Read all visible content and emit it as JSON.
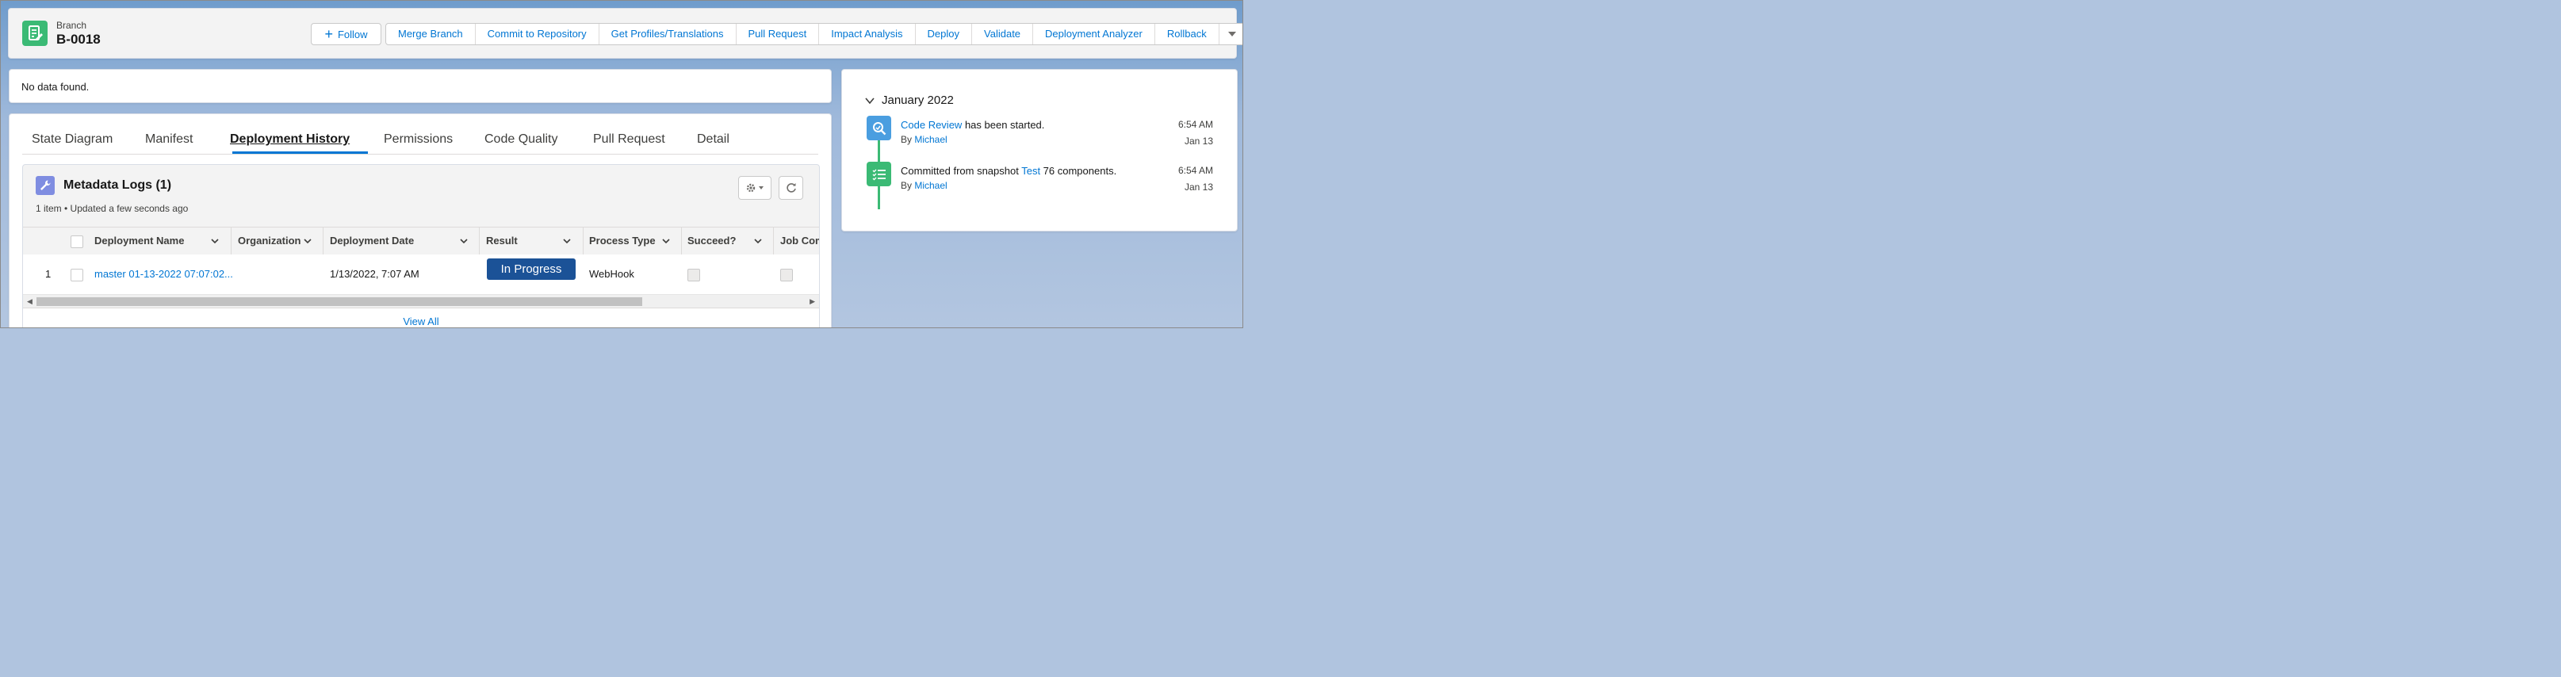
{
  "header": {
    "object_type": "Branch",
    "record_name": "B-0018",
    "follow_label": "Follow",
    "actions": [
      "Merge Branch",
      "Commit to Repository",
      "Get Profiles/Translations",
      "Pull Request",
      "Impact Analysis",
      "Deploy",
      "Validate",
      "Deployment Analyzer",
      "Rollback"
    ]
  },
  "notice": {
    "text": "No data found."
  },
  "tabs": [
    "State Diagram",
    "Manifest",
    "Deployment History",
    "Permissions",
    "Code Quality",
    "Pull Request",
    "Detail"
  ],
  "related_list": {
    "title": "Metadata Logs (1)",
    "subtitle": "1 item • Updated a few seconds ago",
    "columns": [
      "Deployment Name",
      "Organization",
      "Deployment Date",
      "Result",
      "Process Type",
      "Succeed?",
      "Job Com"
    ],
    "rows": [
      {
        "index": "1",
        "deployment_name": "master 01-13-2022 07:07:02...",
        "organization": "",
        "deployment_date": "1/13/2022, 7:07 AM",
        "result": "In Progress",
        "process_type": "WebHook"
      }
    ],
    "view_all": "View All"
  },
  "activity": {
    "month": "January 2022",
    "events": [
      {
        "link": "Code Review",
        "text": " has been started.",
        "by_prefix": "By ",
        "by": "Michael",
        "time": "6:54 AM",
        "date": "Jan 13"
      },
      {
        "prefix": "Committed from snapshot ",
        "link": "Test",
        "text": " 76 components.",
        "by_prefix": "By ",
        "by": "Michael",
        "time": "6:54 AM",
        "date": "Jan 13"
      }
    ]
  },
  "colors": {
    "accent": "#0176d3",
    "branch_icon": "#3bba75",
    "badge": "#1b5297",
    "review_icon": "#4a9ee0"
  }
}
